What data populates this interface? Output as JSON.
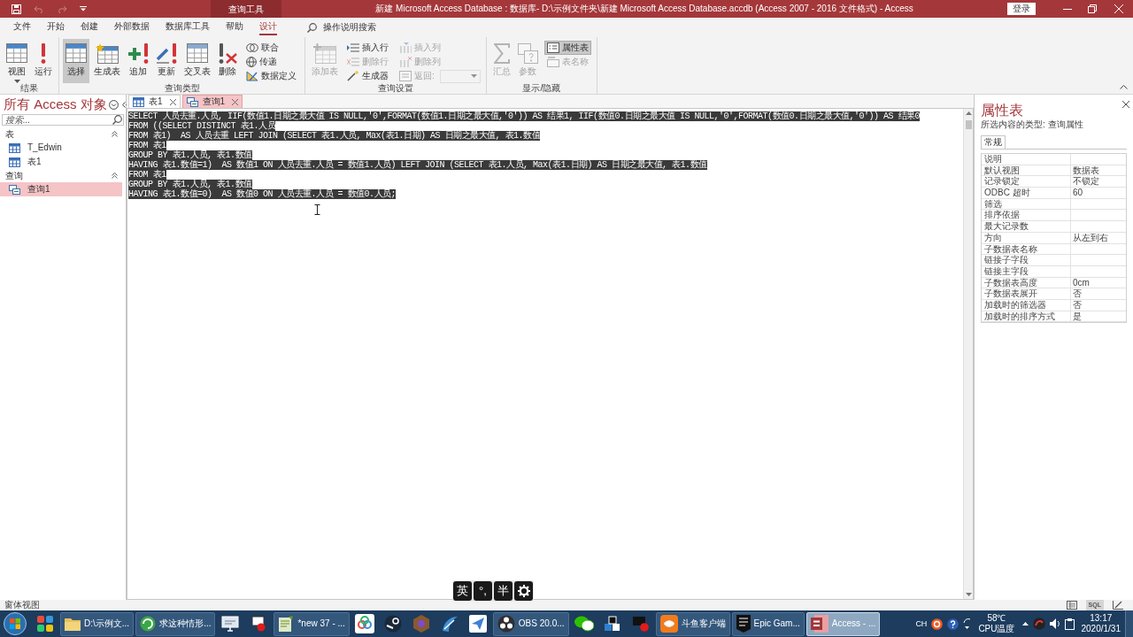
{
  "title_bar": {
    "quick_access": [
      {
        "disabled": false
      },
      {
        "disabled": true
      },
      {
        "disabled": true
      },
      {
        "disabled": false
      }
    ],
    "context_tab": "查询工具",
    "title": "新建 Microsoft Access Database : 数据库- D:\\示例文件夹\\新建 Microsoft Access Database.accdb (Access 2007 - 2016 文件格式) - Access",
    "sign_in": "登录"
  },
  "menu_tabs": [
    {
      "label": "文件",
      "selected": false
    },
    {
      "label": "开始",
      "selected": false
    },
    {
      "label": "创建",
      "selected": false
    },
    {
      "label": "外部数据",
      "selected": false
    },
    {
      "label": "数据库工具",
      "selected": false
    },
    {
      "label": "帮助",
      "selected": false
    },
    {
      "label": "设计",
      "selected": true
    }
  ],
  "tell_me": {
    "placeholder": "操作说明搜索"
  },
  "ribbon": {
    "groups": [
      {
        "label": "结果",
        "buttons": [
          {
            "label": "视图",
            "kind": "split",
            "selected": false,
            "disabled": false
          },
          {
            "label": "运行",
            "kind": "large",
            "selected": false,
            "disabled": false
          }
        ]
      },
      {
        "label": "查询类型",
        "buttons": [
          {
            "label": "选择",
            "kind": "large",
            "selected": true,
            "disabled": false
          },
          {
            "label": "生成表",
            "kind": "large",
            "selected": false,
            "disabled": false
          },
          {
            "label": "追加",
            "kind": "large",
            "selected": false,
            "disabled": false
          },
          {
            "label": "更新",
            "kind": "large",
            "selected": false,
            "disabled": false
          },
          {
            "label": "交叉表",
            "kind": "large",
            "selected": false,
            "disabled": false
          },
          {
            "label": "删除",
            "kind": "large",
            "selected": false,
            "disabled": false
          },
          {
            "label": "联合",
            "kind": "small",
            "selected": false,
            "disabled": false
          },
          {
            "label": "传递",
            "kind": "small",
            "selected": false,
            "disabled": false
          },
          {
            "label": "数据定义",
            "kind": "small",
            "selected": false,
            "disabled": false
          }
        ]
      },
      {
        "label": "查询设置",
        "buttons": [
          {
            "label": "添加表",
            "kind": "large",
            "selected": false,
            "disabled": true
          },
          {
            "label": "插入行",
            "kind": "small",
            "selected": false,
            "disabled": false
          },
          {
            "label": "删除行",
            "kind": "small",
            "selected": false,
            "disabled": true
          },
          {
            "label": "生成器",
            "kind": "small",
            "selected": false,
            "disabled": false
          },
          {
            "label": "插入列",
            "kind": "small",
            "selected": false,
            "disabled": true
          },
          {
            "label": "删除列",
            "kind": "small",
            "selected": false,
            "disabled": true
          },
          {
            "label": "返回:",
            "kind": "combo",
            "selected": false,
            "disabled": true
          }
        ]
      },
      {
        "label": "显示/隐藏",
        "buttons": [
          {
            "label": "汇总",
            "kind": "large",
            "selected": false,
            "disabled": true
          },
          {
            "label": "参数",
            "kind": "large",
            "selected": false,
            "disabled": true
          },
          {
            "label": "属性表",
            "kind": "small",
            "selected": true,
            "disabled": false
          },
          {
            "label": "表名称",
            "kind": "small",
            "selected": false,
            "disabled": true
          }
        ]
      }
    ]
  },
  "nav_pane": {
    "title": "所有 Access 对象",
    "search": {
      "placeholder": "搜索..."
    },
    "groups": [
      {
        "label": "表",
        "expanded": true,
        "items": [
          {
            "label": "T_Edwin",
            "kind": "table",
            "selected": false
          },
          {
            "label": "表1",
            "kind": "table",
            "selected": false
          }
        ]
      },
      {
        "label": "查询",
        "expanded": true,
        "items": [
          {
            "label": "查询1",
            "kind": "query",
            "selected": true
          }
        ]
      }
    ]
  },
  "document_tabs": [
    {
      "label": "表1",
      "kind": "table",
      "selected": false
    },
    {
      "label": "查询1",
      "kind": "query",
      "selected": true
    }
  ],
  "sql_editor": {
    "selected": true,
    "lines": [
      "SELECT 人员去重.人员, IIF(数值1.日期之最大值 IS NULL,'0',FORMAT(数值1.日期之最大值,'0')) AS 结果1, IIF(数值0.日期之最大值 IS NULL,'0',FORMAT(数值0.日期之最大值,'0')) AS 结果0",
      "FROM ((SELECT DISTINCT 表1.人员",
      "FROM 表1)  AS 人员去重 LEFT JOIN (SELECT 表1.人员, Max(表1.日期) AS 日期之最大值, 表1.数值",
      "FROM 表1",
      "GROUP BY 表1.人员, 表1.数值",
      "HAVING 表1.数值=1)  AS 数值1 ON 人员去重.人员 = 数值1.人员) LEFT JOIN (SELECT 表1.人员, Max(表1.日期) AS 日期之最大值, 表1.数值",
      "FROM 表1",
      "GROUP BY 表1.人员, 表1.数值",
      "HAVING 表1.数值=0)  AS 数值0 ON 人员去重.人员 = 数值0.人员;"
    ]
  },
  "ime_toolbar": {
    "buttons": [
      "英",
      "°,",
      "半"
    ]
  },
  "property_sheet": {
    "title": "属性表",
    "selection_type": "所选内容的类型: 查询属性",
    "tabs": [
      {
        "label": "常规",
        "selected": true
      }
    ],
    "properties": [
      {
        "name": "说明"
      },
      {
        "name": "默认视图",
        "value": "数据表"
      },
      {
        "name": "记录锁定",
        "value": "不锁定"
      },
      {
        "name": "ODBC 超时",
        "value": "60"
      },
      {
        "name": "筛选"
      },
      {
        "name": "排序依据"
      },
      {
        "name": "最大记录数"
      },
      {
        "name": "方向",
        "value": "从左到右"
      },
      {
        "name": "子数据表名称"
      },
      {
        "name": "链接子字段"
      },
      {
        "name": "链接主字段"
      },
      {
        "name": "子数据表高度",
        "value": "0cm"
      },
      {
        "name": "子数据表展开",
        "value": "否"
      },
      {
        "name": "加载时的筛选器",
        "value": "否"
      },
      {
        "name": "加载时的排序方式",
        "value": "是"
      }
    ]
  },
  "status_bar": {
    "text": "窗体视图",
    "views": [
      {
        "selected": false
      },
      {
        "label": "SQL",
        "selected": true
      },
      {
        "selected": false
      }
    ]
  },
  "taskbar": {
    "items": [
      {
        "active": false
      },
      {
        "label": "D:\\示例文...",
        "active": false
      },
      {
        "label": "求这种情形...",
        "active": false
      },
      {
        "active": false
      },
      {
        "active": false
      },
      {
        "label": "*new 37 - ...",
        "active": false
      },
      {
        "active": false
      },
      {
        "active": false
      },
      {
        "active": false
      },
      {
        "active": false
      },
      {
        "active": false
      },
      {
        "label": "OBS 20.0...",
        "active": false
      },
      {
        "active": false
      },
      {
        "active": false
      },
      {
        "active": false
      },
      {
        "label": "斗鱼客户端",
        "active": false
      },
      {
        "label": "Epic Gam...",
        "active": false
      },
      {
        "label": "Access - ...",
        "active": true
      }
    ],
    "tray": {
      "language": "CH",
      "temperature": "58℃",
      "temperature_caption": "CPU温度",
      "time": "13:17",
      "date": "2020/1/31"
    }
  }
}
